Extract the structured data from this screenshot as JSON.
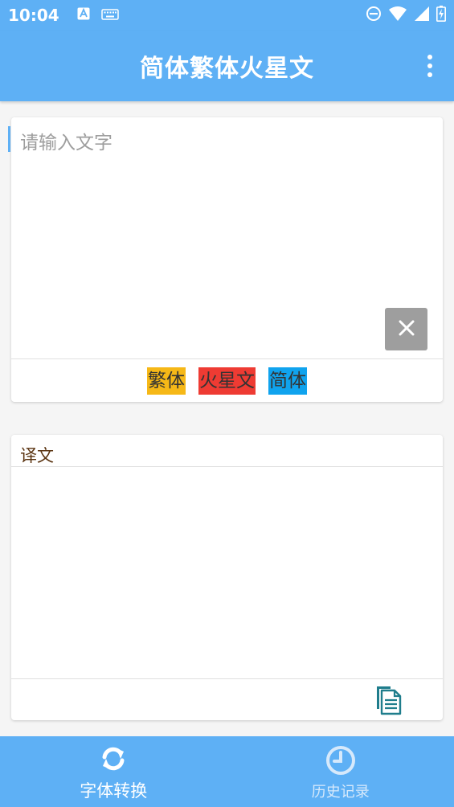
{
  "status_bar": {
    "time": "10:04",
    "left_icons": [
      "font-notification-icon",
      "keyboard-icon"
    ],
    "right_icons": [
      "do-not-disturb-icon",
      "wifi-icon",
      "cell-signal-icon",
      "battery-icon"
    ]
  },
  "app_bar": {
    "title": "简体繁体火星文",
    "menu_icon": "more-vert-icon"
  },
  "input_card": {
    "placeholder": "请输入文字",
    "value": "",
    "clear_icon": "close-icon",
    "buttons": {
      "traditional": "繁体",
      "martian": "火星文",
      "simplified": "简体"
    }
  },
  "output_card": {
    "label": "译文",
    "text": "",
    "copy_icon": "copy-document-icon"
  },
  "bottom_nav": {
    "items": [
      {
        "label": "字体转换",
        "icon": "sync-icon",
        "active": true
      },
      {
        "label": "历史记录",
        "icon": "clock-icon",
        "active": false
      }
    ]
  },
  "colors": {
    "primary": "#5eb0f5",
    "traditional_button": "#f6b817",
    "martian_button": "#ee3b33",
    "simplified_button": "#10a3ee",
    "clear_button": "#9e9e9e",
    "label_brown": "#5a3310"
  }
}
